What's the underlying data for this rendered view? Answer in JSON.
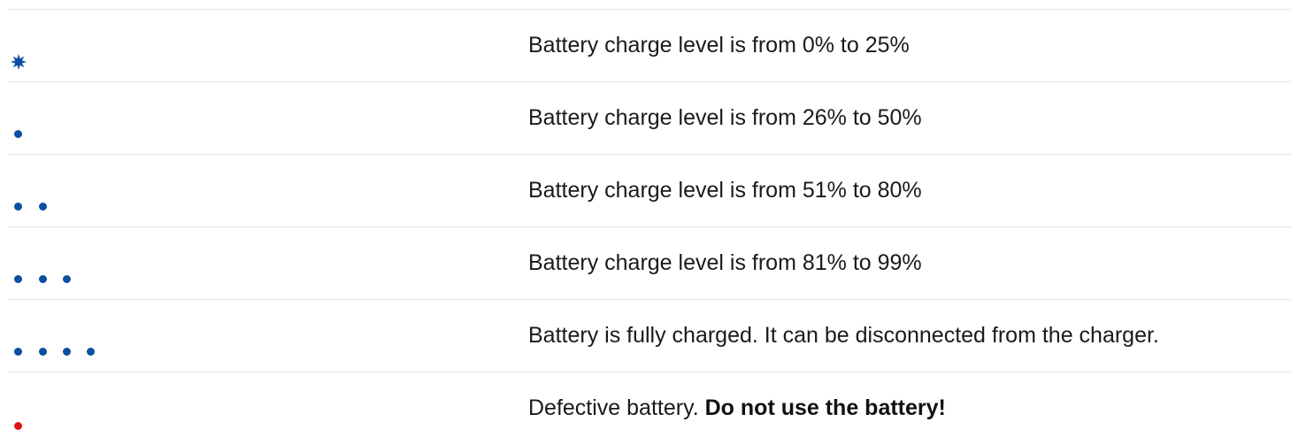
{
  "colors": {
    "indicator_blue": "#0a4fa0",
    "indicator_red": "#e0141b",
    "divider": "#e3e3e3"
  },
  "rows": [
    {
      "indicator": "blinking-star-icon",
      "description": "Battery charge level is from 0% to 25%"
    },
    {
      "indicator": "one-blue-dot",
      "dots": 1,
      "description": "Battery charge level is from 26% to 50%"
    },
    {
      "indicator": "two-blue-dots",
      "dots": 2,
      "description": "Battery charge level is from 51% to 80%"
    },
    {
      "indicator": "three-blue-dots",
      "dots": 3,
      "description": "Battery charge level is from 81% to 99%"
    },
    {
      "indicator": "four-blue-dots",
      "dots": 4,
      "description": "Battery is fully charged. It can be disconnected from the charger."
    },
    {
      "indicator": "one-red-dot",
      "dots": 1,
      "description": "Defective battery. ",
      "warning": "Do not use the battery!"
    }
  ]
}
